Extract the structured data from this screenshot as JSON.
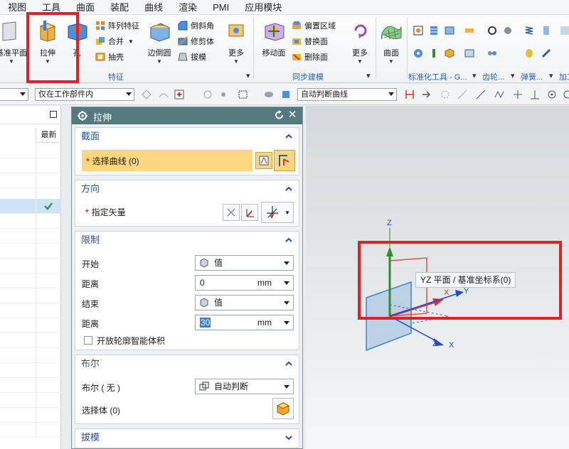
{
  "menu": [
    "视图",
    "工具",
    "曲面",
    "装配",
    "曲线",
    "渲染",
    "PMI",
    "应用模块"
  ],
  "ribbon": {
    "datum_plane": "基准平面",
    "extrude": "拉伸",
    "hole": "孔",
    "feature_small": [
      "阵列特征",
      "合并",
      "抽壳"
    ],
    "edge_blend": "边倒圆",
    "detail_small": [
      "倒斜角",
      "修剪体",
      "拔模"
    ],
    "more1": "更多",
    "move_face": "移动面",
    "sync_small": [
      "偏置区域",
      "替换面",
      "删除面"
    ],
    "more2": "更多",
    "surface": "曲面",
    "groups": {
      "feature": "特征",
      "sync": "同步建模",
      "std": "标准化工具 - G...",
      "gear": "齿轮...",
      "spring": "弹簧...",
      "add": "加工"
    }
  },
  "selection": {
    "type_filter": "",
    "scope": "仅在工作部件内",
    "curve_rule": "自动判断曲线"
  },
  "navigator": {
    "col_latest": "最新"
  },
  "dialog": {
    "title": "拉伸",
    "section_label": "截面",
    "select_curve": "选择曲线 (0)",
    "direction_label": "方向",
    "specify_vector": "指定矢量",
    "limits_label": "限制",
    "start_label": "开始",
    "start_value": "值",
    "distance_label": "距离",
    "start_distance": "0",
    "end_label": "结束",
    "end_value": "值",
    "end_distance": "30",
    "unit": "mm",
    "open_profile": "开放轮廓智能体积",
    "boolean_label": "布尔",
    "boolean_field": "布尔 ( 无 )",
    "boolean_value": "自动判断",
    "select_body": "选择体 (0)",
    "draft_label": "拔模"
  },
  "viewport": {
    "tooltip": "YZ 平面 / 基准坐标系(0)",
    "axis_z": "Z",
    "axis_x": "X",
    "axis_y": "Y",
    "axis_z2": "Z",
    "axis_x2": "X",
    "colors": {
      "x": "#d9322b",
      "y": "#1e48d8",
      "z": "#2f8d2c",
      "plane": "#3d86c9"
    }
  },
  "colors": {
    "dialog_title_bg": "#55797e",
    "highlight_red": "#e02127",
    "section_yellow": "#fcd781",
    "link_blue": "#2b4f8f"
  }
}
